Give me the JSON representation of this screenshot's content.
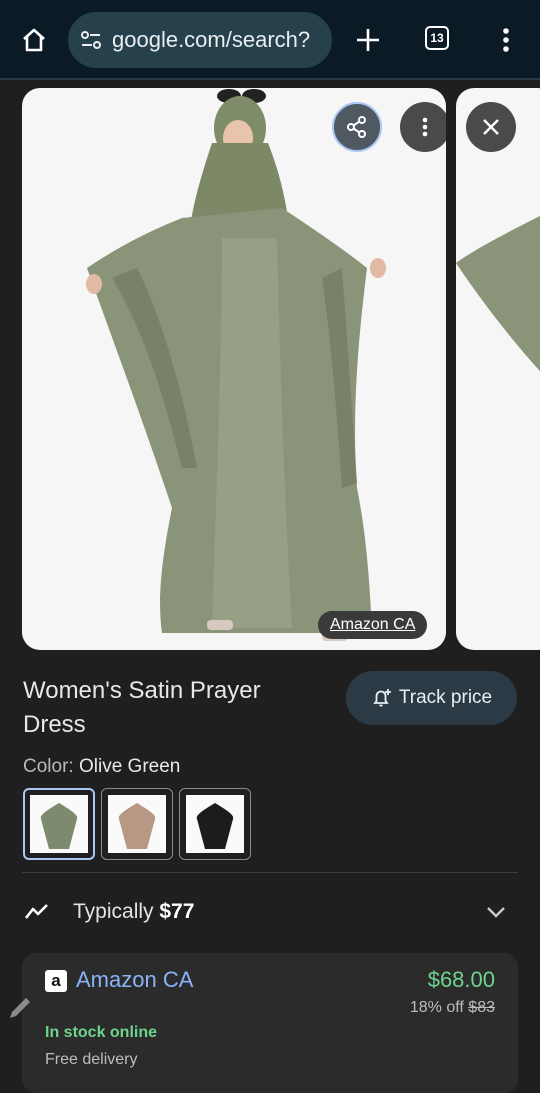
{
  "browser": {
    "url": "google.com/search?",
    "tab_count": "13"
  },
  "image": {
    "source_label": "Amazon CA"
  },
  "product": {
    "title": "Women's Satin Prayer Dress",
    "track_label": "Track price",
    "color_label": "Color:",
    "color_value": "Olive Green",
    "swatch_colors": [
      "#7d8a6e",
      "#b89784",
      "#1c1c1c"
    ]
  },
  "price_insight": {
    "label": "Typically",
    "value": "$77"
  },
  "offer": {
    "store": "Amazon CA",
    "price": "$68.00",
    "discount": "18% off",
    "original_price": "$83",
    "stock": "In stock online",
    "delivery": "Free delivery"
  },
  "colors": {
    "accent_blue": "#8ab4f8",
    "price_green": "#6dd58c",
    "background": "#1f1f1f"
  }
}
